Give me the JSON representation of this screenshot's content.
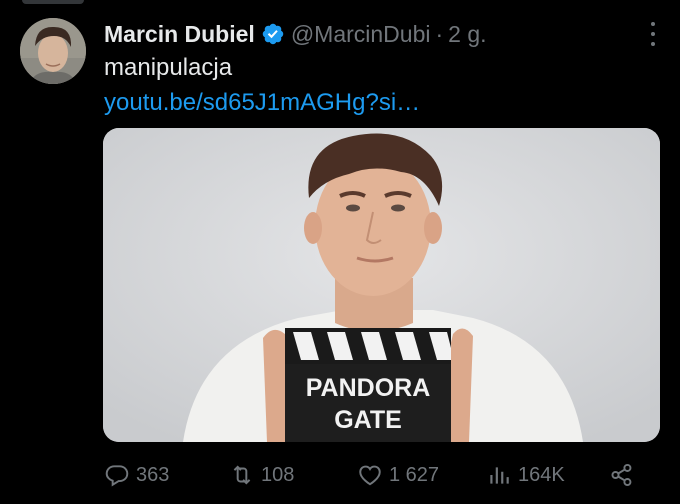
{
  "tweet": {
    "display_name": "Marcin Dubiel",
    "handle": "@MarcinDubi",
    "separator": "·",
    "time": "2 g.",
    "text": "manipulacja",
    "link": "youtu.be/sd65J1mAGHg?si…"
  },
  "media": {
    "clapper_line1": "PANDORA",
    "clapper_line2": "GATE"
  },
  "actions": {
    "replies": "363",
    "retweets": "108",
    "likes": "1 627",
    "views": "164K"
  },
  "colors": {
    "background": "#000000",
    "primary_text": "#e7e9ea",
    "secondary_text": "#71767b",
    "link": "#1d9bf0",
    "verified": "#1d9bf0"
  },
  "icons": [
    "verified-badge-icon",
    "more-icon",
    "reply-icon",
    "retweet-icon",
    "like-icon",
    "views-icon",
    "share-icon"
  ]
}
